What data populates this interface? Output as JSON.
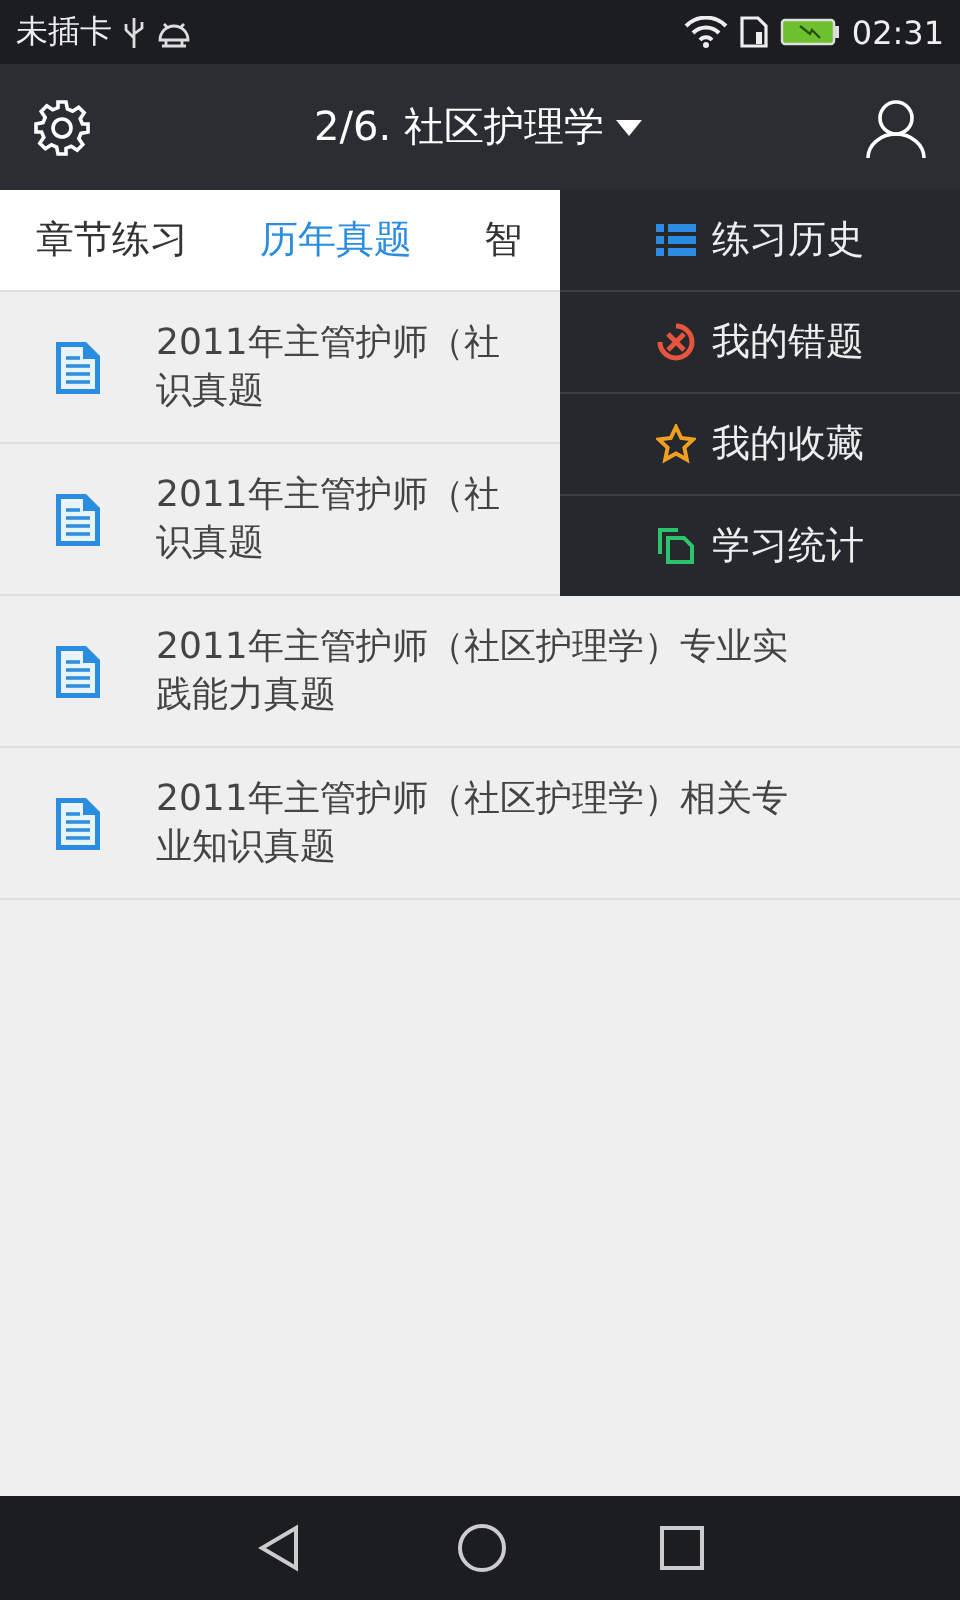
{
  "status_bar": {
    "carrier": "未插卡",
    "time": "02:31"
  },
  "header": {
    "title": "2/6. 社区护理学"
  },
  "tabs": [
    {
      "label": "章节练习",
      "selected": false
    },
    {
      "label": "历年真题",
      "selected": true
    },
    {
      "label": "智",
      "selected": false
    }
  ],
  "list": [
    {
      "lines": [
        "2011年主管护师（社",
        "识真题"
      ]
    },
    {
      "lines": [
        "2011年主管护师（社",
        "识真题"
      ]
    },
    {
      "lines": [
        "2011年主管护师（社区护理学）专业实",
        "践能力真题"
      ]
    },
    {
      "lines": [
        "2011年主管护师（社区护理学）相关专",
        "业知识真题"
      ]
    }
  ],
  "menu": [
    {
      "kind": "history",
      "label": "练习历史"
    },
    {
      "kind": "mistakes",
      "label": "我的错题"
    },
    {
      "kind": "favorites",
      "label": "我的收藏"
    },
    {
      "kind": "stats",
      "label": "学习统计"
    }
  ]
}
